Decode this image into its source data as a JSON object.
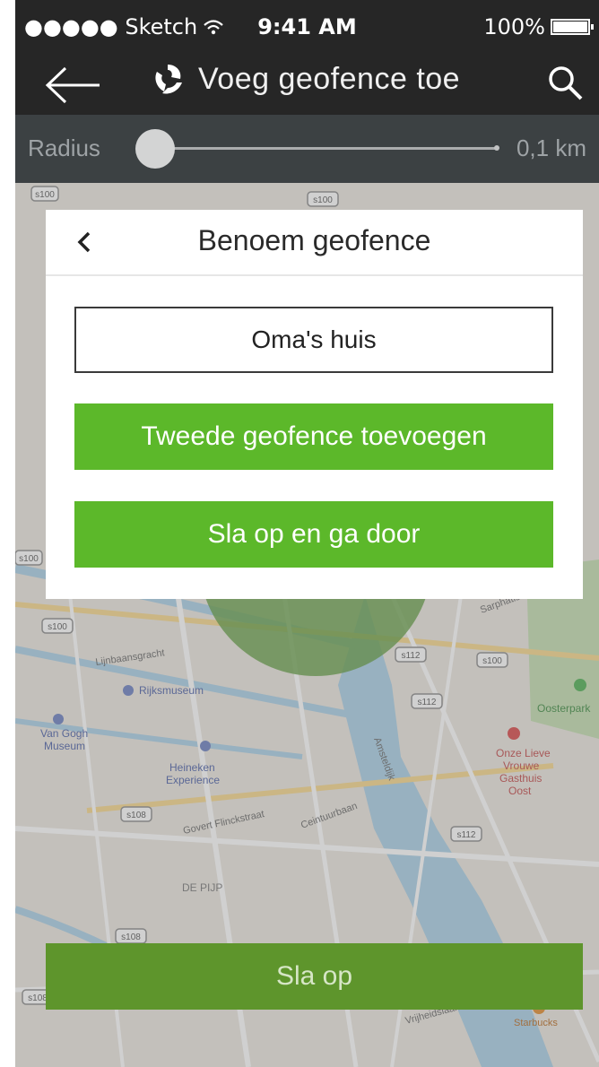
{
  "status_bar": {
    "carrier": "●●●●● Sketch",
    "time": "9:41 AM",
    "battery": "100%"
  },
  "nav": {
    "title": "Voeg geofence toe",
    "back_icon": "arrow-left-icon",
    "logo_icon": "app-logo-icon",
    "search_icon": "search-icon"
  },
  "radius": {
    "label": "Radius",
    "value": "0,1 km",
    "slider_fraction": 0.0
  },
  "modal": {
    "title": "Benoem geofence",
    "back_icon": "chevron-left-icon",
    "name_value": "Oma's huis",
    "add_second_label": "Tweede geofence toevoegen",
    "save_continue_label": "Sla op en ga door"
  },
  "bottom": {
    "save_label": "Sla op"
  },
  "map": {
    "labels": [
      "Rijksmuseum",
      "Van Gogh Museum",
      "Heineken Experience",
      "Onze Lieve Vrouwe Gasthuis Oost",
      "Oosterpark",
      "DE PIJP",
      "Starbucks",
      "Ceintuurbaan",
      "Amsteldijk",
      "Vrijheidslaan",
      "Lijnbaansgracht",
      "Sarphatistraat",
      "Govert Flinckstraat"
    ],
    "road_badges": [
      "s100",
      "s100",
      "s100",
      "s100",
      "s100",
      "s112",
      "s112",
      "s112",
      "s108",
      "s108",
      "s108"
    ]
  },
  "colors": {
    "accent_green": "#5cb82a",
    "bottom_button": "#5e952c",
    "nav_bg": "#262626",
    "radius_bg": "#2f3538"
  }
}
